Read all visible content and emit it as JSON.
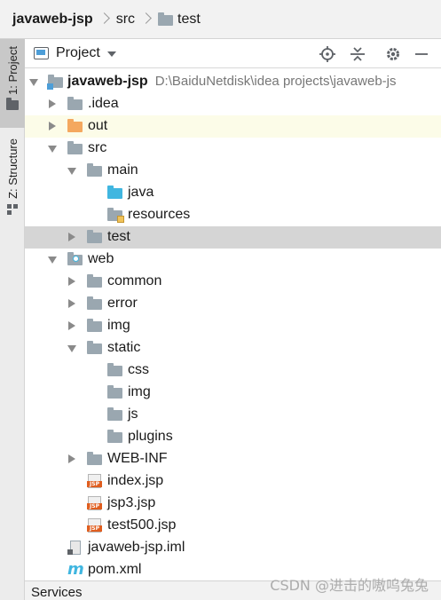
{
  "breadcrumb": {
    "items": [
      "javaweb-jsp",
      "src",
      "test"
    ]
  },
  "toolstrip": {
    "project_tab": "1: Project",
    "structure_tab": "Z: Structure"
  },
  "panel": {
    "title": "Project"
  },
  "tree": [
    {
      "label": "javaweb-jsp",
      "path": "D:\\BaiduNetdisk\\idea projects\\javaweb-js",
      "icon": "module-folder-icon",
      "expanded": true
    },
    {
      "label": ".idea",
      "icon": "folder-icon",
      "expanded": false
    },
    {
      "label": "out",
      "icon": "excluded-folder-icon",
      "expanded": false
    },
    {
      "label": "src",
      "icon": "folder-icon",
      "expanded": true
    },
    {
      "label": "main",
      "icon": "folder-icon",
      "expanded": true
    },
    {
      "label": "java",
      "icon": "source-folder-icon"
    },
    {
      "label": "resources",
      "icon": "resources-folder-icon"
    },
    {
      "label": "test",
      "icon": "folder-icon",
      "expanded": false,
      "selected": true
    },
    {
      "label": "web",
      "icon": "web-folder-icon",
      "expanded": true
    },
    {
      "label": "common",
      "icon": "folder-icon",
      "expanded": false
    },
    {
      "label": "error",
      "icon": "folder-icon",
      "expanded": false
    },
    {
      "label": "img",
      "icon": "folder-icon",
      "expanded": false
    },
    {
      "label": "static",
      "icon": "folder-icon",
      "expanded": true
    },
    {
      "label": "css",
      "icon": "folder-icon"
    },
    {
      "label": "img",
      "icon": "folder-icon"
    },
    {
      "label": "js",
      "icon": "folder-icon"
    },
    {
      "label": "plugins",
      "icon": "folder-icon"
    },
    {
      "label": "WEB-INF",
      "icon": "folder-icon",
      "expanded": false
    },
    {
      "label": "index.jsp",
      "icon": "jsp-file-icon",
      "badge": "JSP"
    },
    {
      "label": "jsp3.jsp",
      "icon": "jsp-file-icon",
      "badge": "JSP"
    },
    {
      "label": "test500.jsp",
      "icon": "jsp-file-icon",
      "badge": "JSP"
    },
    {
      "label": "javaweb-jsp.iml",
      "icon": "iml-file-icon"
    },
    {
      "label": "pom.xml",
      "icon": "maven-icon",
      "glyph": "m"
    }
  ],
  "footer": {
    "services": "Services"
  },
  "watermark": "CSDN @进击的嗷呜兔兔"
}
